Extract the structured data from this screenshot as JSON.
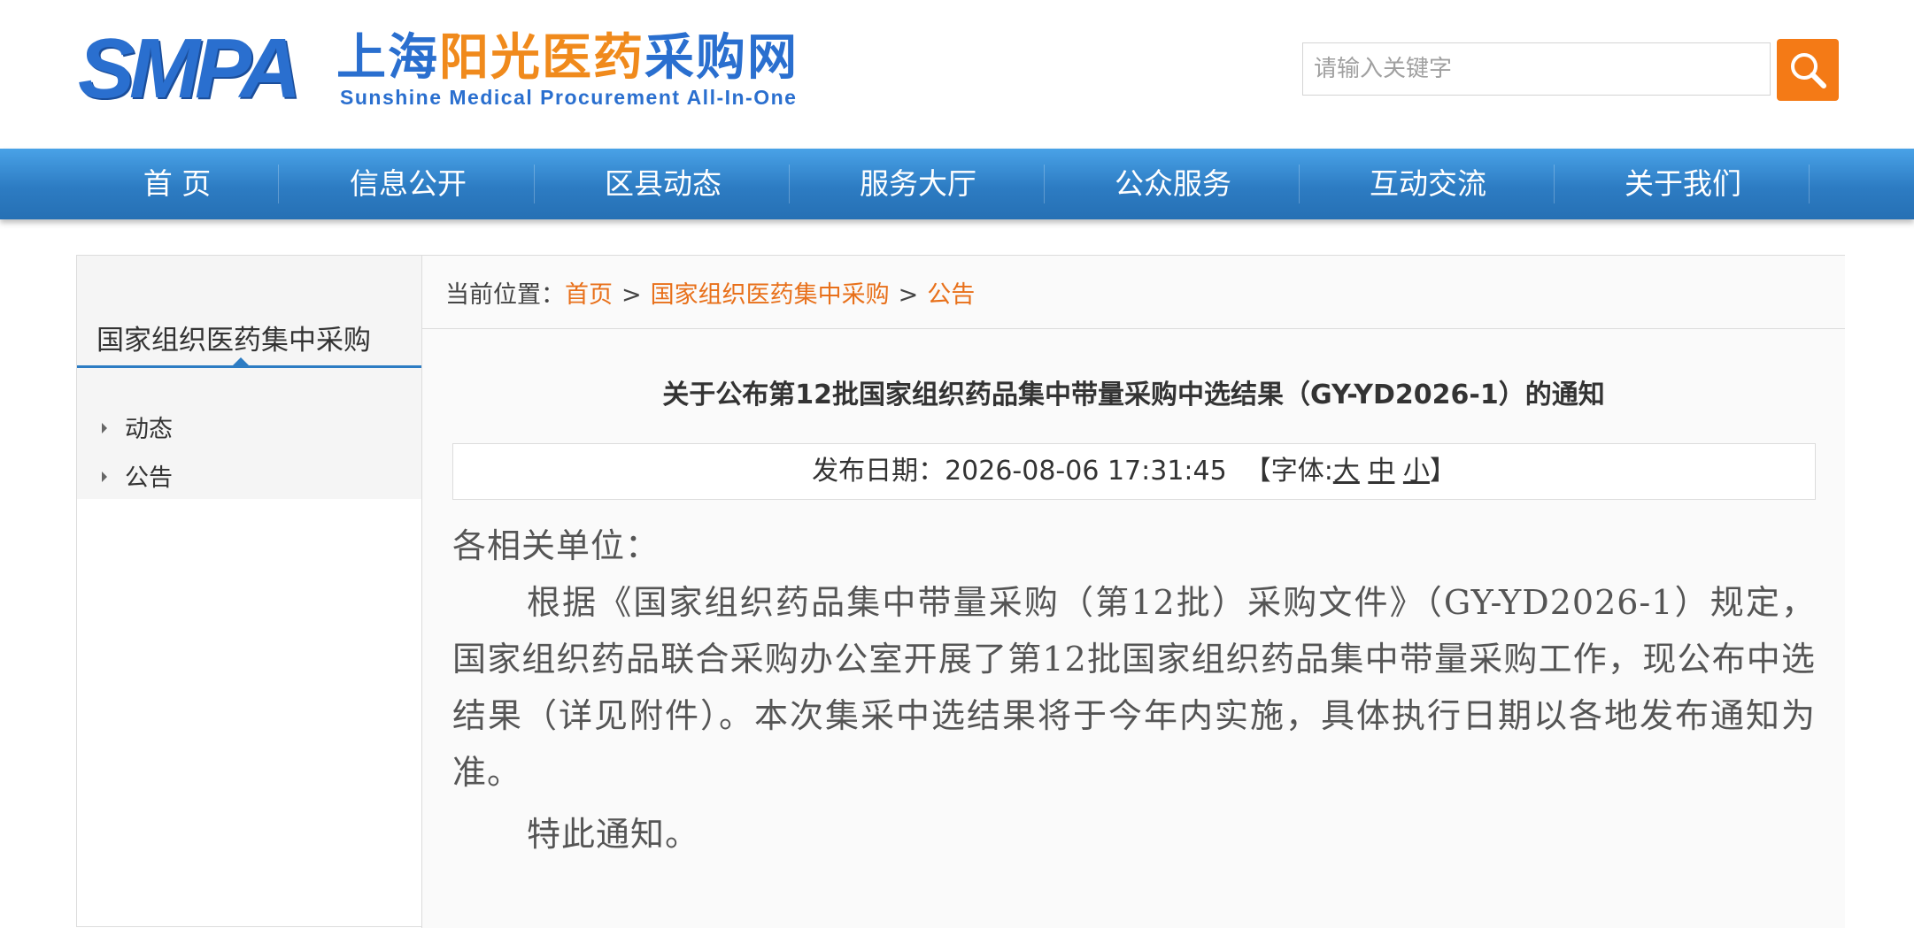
{
  "header": {
    "logo_smpa": "SMPA",
    "logo_cn_part1": "上海",
    "logo_cn_part2": "阳光医药",
    "logo_cn_part3": "采购网",
    "logo_en": "Sunshine Medical Procurement All-In-One",
    "search_placeholder": "请输入关键字",
    "search_icon": "magnifier-icon"
  },
  "nav": {
    "items": [
      "首 页",
      "信息公开",
      "区县动态",
      "服务大厅",
      "公众服务",
      "互动交流",
      "关于我们"
    ]
  },
  "sidebar": {
    "title": "国家组织医药集中采购",
    "items": [
      "动态",
      "公告"
    ]
  },
  "breadcrumb": {
    "prefix": "当前位置：",
    "items": [
      "首页",
      "国家组织医药集中采购",
      "公告"
    ],
    "separator": ">"
  },
  "article": {
    "title": "关于公布第12批国家组织药品集中带量采购中选结果（GY-YD2026-1）的通知",
    "date_label": "发布日期：",
    "date_value": "2026-08-06 17:31:45",
    "font_label_open": "【字体:",
    "font_sizes": [
      "大",
      "中",
      "小"
    ],
    "font_label_close": "】",
    "salutation": "各相关单位：",
    "paragraph": "根据《国家组织药品集中带量采购（第12批）采购文件》（GY-YD2026-1）规定，国家组织药品联合采购办公室开展了第12批国家组织药品集中带量采购工作，现公布中选结果（详见附件）。本次集采中选结果将于今年内实施，具体执行日期以各地发布通知为准。",
    "closing": "特此通知。"
  },
  "colors": {
    "brand_blue": "#2a6fcf",
    "brand_orange": "#f08a1c",
    "nav_blue": "#2d7cc3",
    "link_orange": "#e8701a",
    "search_button": "#f47a16"
  }
}
